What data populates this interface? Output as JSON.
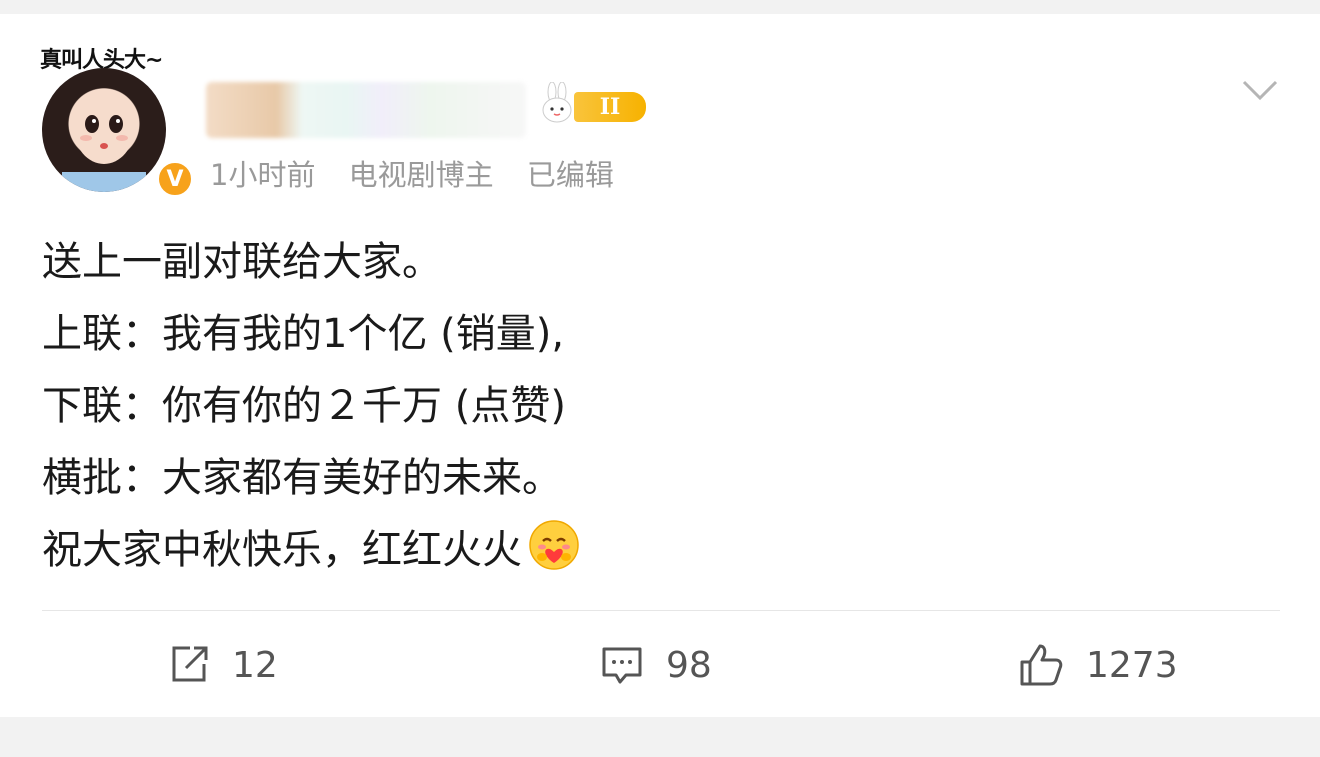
{
  "avatar": {
    "banner_text": "真叫人头大~",
    "verified_badge": "V"
  },
  "user": {
    "level_badge": "II",
    "time": "1小时前",
    "role": "电视剧博主",
    "edited": "已编辑"
  },
  "post": {
    "lines": [
      "送上一副对联给大家。",
      "上联：我有我的1个亿 (销量),",
      "下联：你有你的２千万 (点赞)",
      "横批：大家都有美好的未来。",
      "祝大家中秋快乐，红红火火"
    ],
    "emoji": "hug-heart-emoji"
  },
  "actions": {
    "repost_count": "12",
    "comment_count": "98",
    "like_count": "1273"
  },
  "colors": {
    "badge": "#f7b200",
    "verified": "#f7a21b",
    "text": "#1a1a1a",
    "meta": "#9a9a9a"
  }
}
